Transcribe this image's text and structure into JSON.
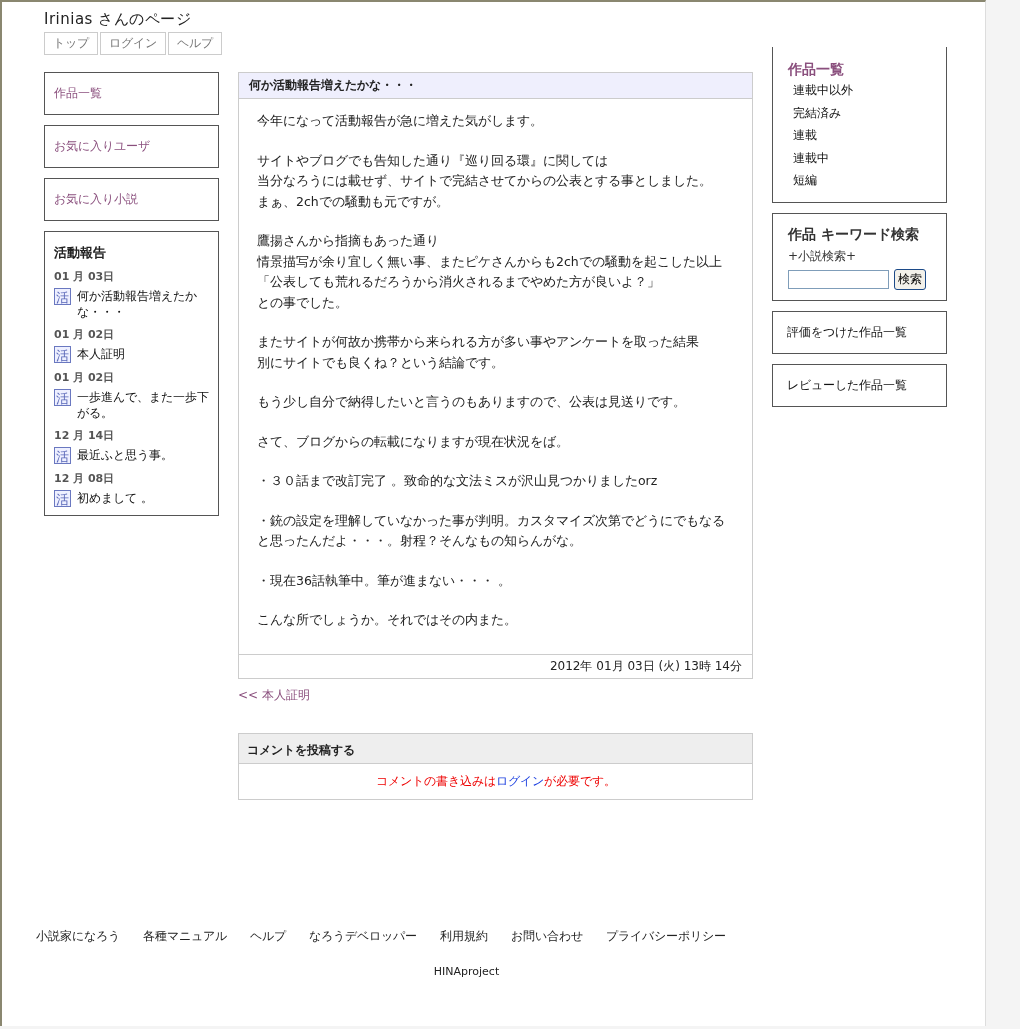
{
  "header": {
    "title": "Irinias さんのページ",
    "nav": [
      "トップ",
      "ログイン",
      "ヘルプ"
    ]
  },
  "left_menu": [
    "作品一覧",
    "お気に入りユーザ",
    "お気に入り小説"
  ],
  "activity": {
    "heading": "活動報告",
    "reports": [
      {
        "date": "01 月 03日",
        "badge": "活",
        "title": "何か活動報告増えたかな・・・"
      },
      {
        "date": "01 月 02日",
        "badge": "活",
        "title": "本人証明"
      },
      {
        "date": "01 月 02日",
        "badge": "活",
        "title": "一歩進んで、また一歩下がる。"
      },
      {
        "date": "12 月 14日",
        "badge": "活",
        "title": "最近ふと思う事。"
      },
      {
        "date": "12 月 08日",
        "badge": "活",
        "title": "初めまして 。"
      }
    ]
  },
  "article": {
    "title": "何か活動報告増えたかな・・・",
    "paragraphs": [
      [
        "今年になって活動報告が急に増えた気がします。"
      ],
      [
        "サイトやブログでも告知した通り『巡り回る環』に関しては",
        "当分なろうには載せず、サイトで完結させてからの公表とする事としました。",
        "まぁ、2chでの騒動も元ですが。"
      ],
      [
        "鷹揚さんから指摘もあった通り",
        "情景描写が余り宜しく無い事、またピケさんからも2chでの騒動を起こした以上",
        "「公表しても荒れるだろうから消火されるまでやめた方が良いよ？」",
        "との事でした。"
      ],
      [
        "またサイトが何故か携帯から来られる方が多い事やアンケートを取った結果",
        "別にサイトでも良くね？という結論です。"
      ],
      [
        "もう少し自分で納得したいと言うのもありますので、公表は見送りです。"
      ],
      [
        "さて、ブログからの転載になりますが現在状況をば。"
      ],
      [
        "・３０話まで改訂完了 。致命的な文法ミスが沢山見つかりましたorz"
      ],
      [
        "・銃の設定を理解していなかった事が判明。カスタマイズ次第でどうにでもなると思ったんだよ・・・。射程？そんなもの知らんがな。"
      ],
      [
        "・現在36話執筆中。筆が進まない・・・ 。"
      ],
      [
        "こんな所でしょうか。それではその内また。"
      ]
    ],
    "posted": "2012年 01月 03日 (火) 13時 14分"
  },
  "prev_link": "<< 本人証明",
  "comment": {
    "heading": "コメントを投稿する",
    "before": "コメントの書き込みは",
    "link": "ログイン",
    "after": "が必要です。"
  },
  "right": {
    "works_heading": "作品一覧",
    "works": [
      "連載中以外",
      "完結済み",
      "連載",
      "連載中",
      "短編"
    ],
    "search": {
      "heading": "作品 キーワード検索",
      "sub": "+小説検索+",
      "button": "検索"
    },
    "links": [
      "評価をつけた作品一覧",
      "レビューした作品一覧"
    ]
  },
  "footer": {
    "links": [
      "小説家になろう",
      "各種マニュアル",
      "ヘルプ",
      "なろうデベロッパー",
      "利用規約",
      "お問い合わせ",
      "プライバシーポリシー"
    ],
    "copyright": "HINAproject"
  }
}
